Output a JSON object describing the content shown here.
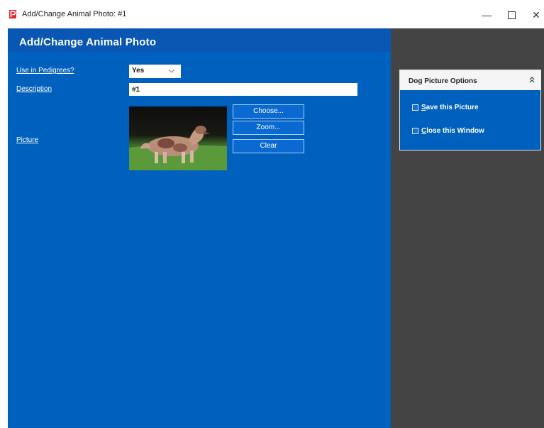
{
  "window": {
    "title": "Add/Change Animal Photo: #1",
    "controls": {
      "minimize": "—",
      "close": "✕"
    }
  },
  "colors": {
    "form_background": "#0060bd",
    "side_background": "#444444",
    "accent_logo": "#e3262f"
  },
  "header": {
    "title": "Add/Change Animal Photo"
  },
  "form": {
    "pedigree": {
      "label": "Use in Pedigrees?",
      "value": "Yes"
    },
    "description": {
      "label": "Description",
      "value": "#1"
    },
    "picture": {
      "label": "Picture",
      "image": "dog-photo"
    }
  },
  "buttons": {
    "choose": "Choose...",
    "zoom": "Zoom...",
    "clear": "Clear"
  },
  "options_panel": {
    "title": "Dog Picture Options",
    "items": [
      {
        "access_key": "S",
        "rest": "ave this Picture",
        "icon": "save-icon"
      },
      {
        "access_key": "C",
        "rest": "lose this Window",
        "icon": "close-window-icon"
      }
    ]
  }
}
